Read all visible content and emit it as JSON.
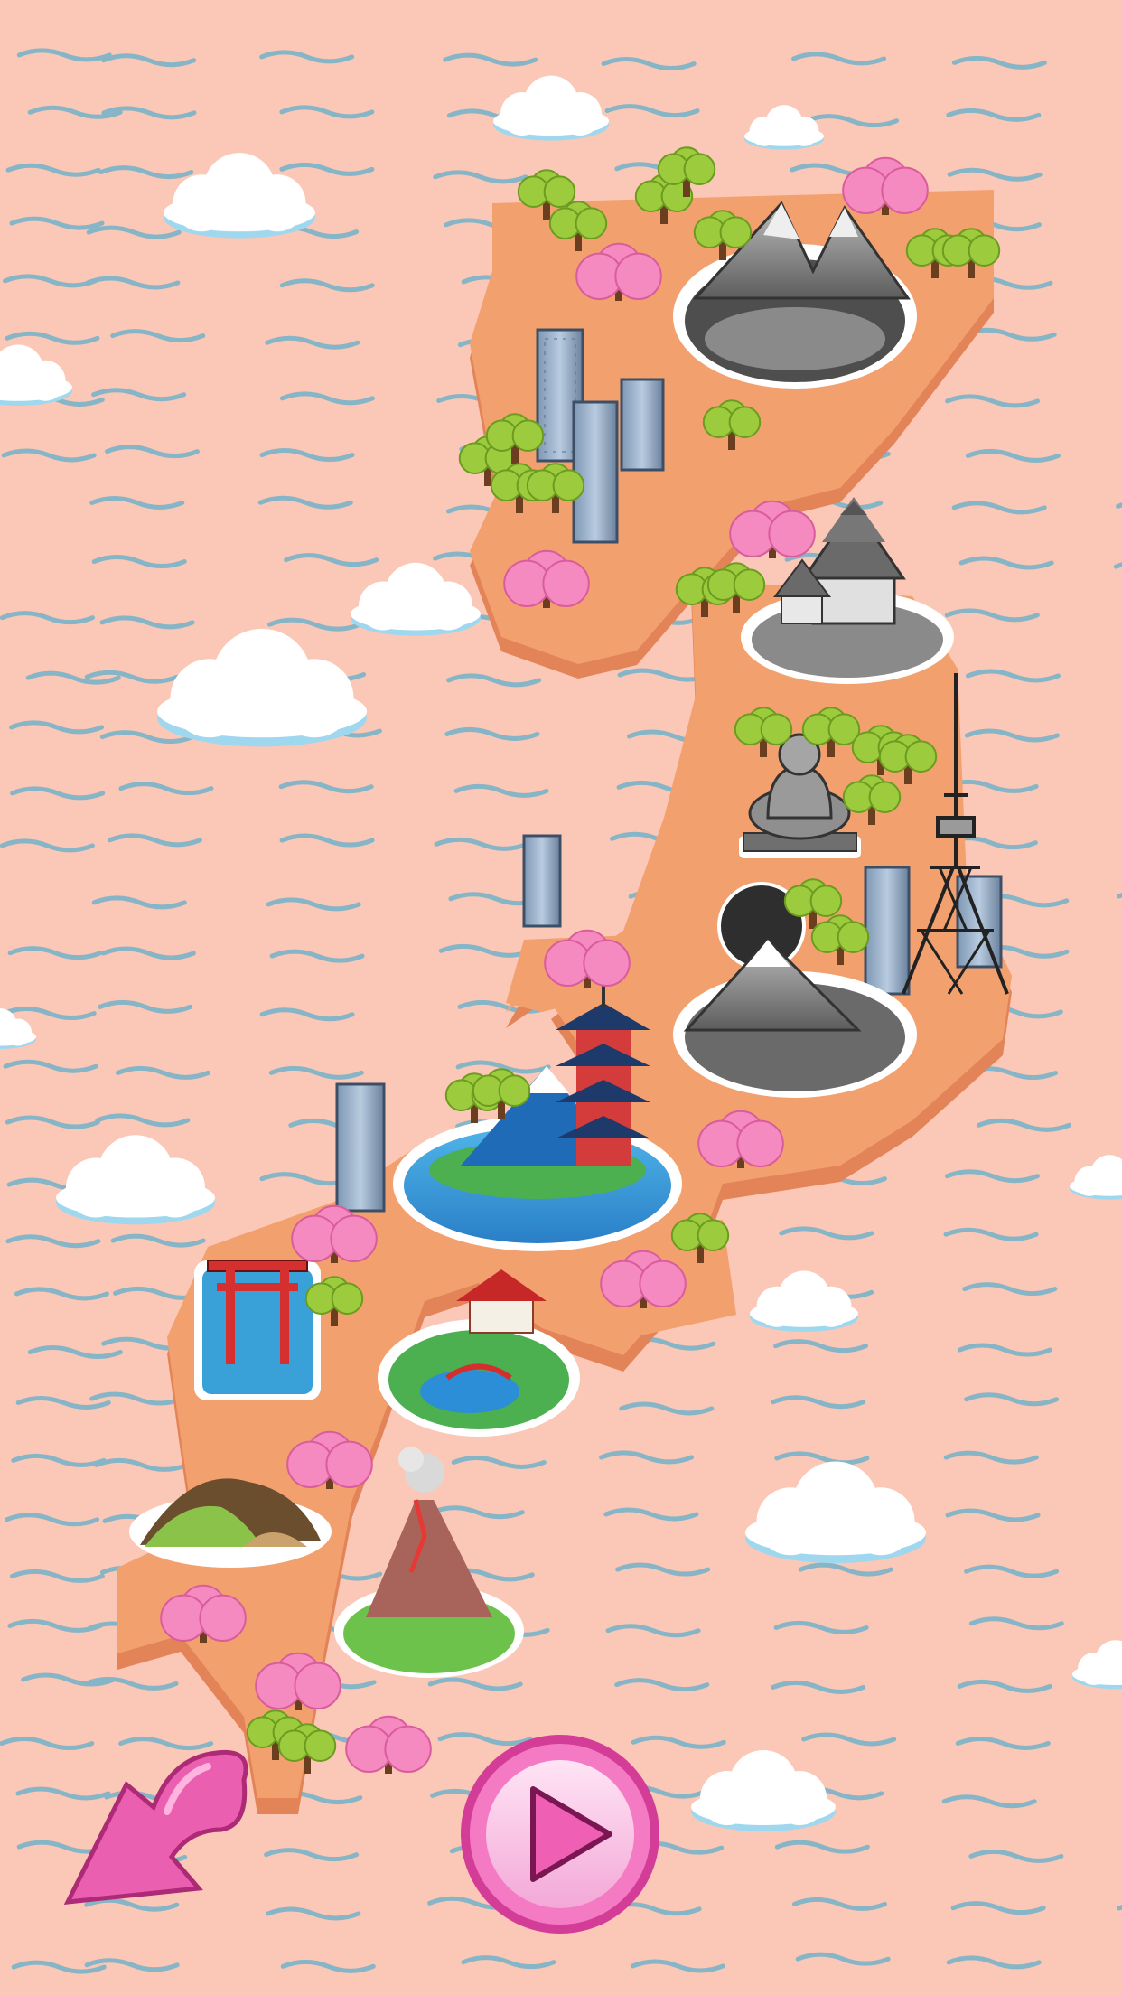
{
  "screen": {
    "kind": "level-select-map",
    "theme": "Japan landmarks map",
    "colors": {
      "sea": "#fbc7b6",
      "wave": "#6fb2c9",
      "land_top": "#f3a06f",
      "land_side": "#e38458",
      "locked_tint": "#9a9a9a",
      "play_button": "#f47bc3",
      "back_arrow": "#ea5fb0"
    }
  },
  "levels": [
    {
      "id": "mountain-lake",
      "icon": "mountain-lake-icon",
      "state": "locked"
    },
    {
      "id": "himeji-castle",
      "icon": "castle-icon",
      "state": "locked"
    },
    {
      "id": "great-buddha",
      "icon": "buddha-icon",
      "state": "locked"
    },
    {
      "id": "tokyo-tower",
      "icon": "tokyo-tower-icon",
      "state": "locked"
    },
    {
      "id": "mount-fuji-sunrise",
      "icon": "mount-fuji-icon",
      "state": "locked"
    },
    {
      "id": "fuji-pagoda",
      "icon": "pagoda-icon",
      "state": "unlocked"
    },
    {
      "id": "torii-gate",
      "icon": "torii-gate-icon",
      "state": "unlocked"
    },
    {
      "id": "garden-temple",
      "icon": "garden-temple-icon",
      "state": "unlocked"
    },
    {
      "id": "rice-hills",
      "icon": "hills-icon",
      "state": "unlocked"
    },
    {
      "id": "volcano",
      "icon": "volcano-icon",
      "state": "unlocked"
    }
  ],
  "controls": {
    "back": {
      "icon": "back-arrow-icon"
    },
    "play": {
      "icon": "play-icon"
    }
  }
}
